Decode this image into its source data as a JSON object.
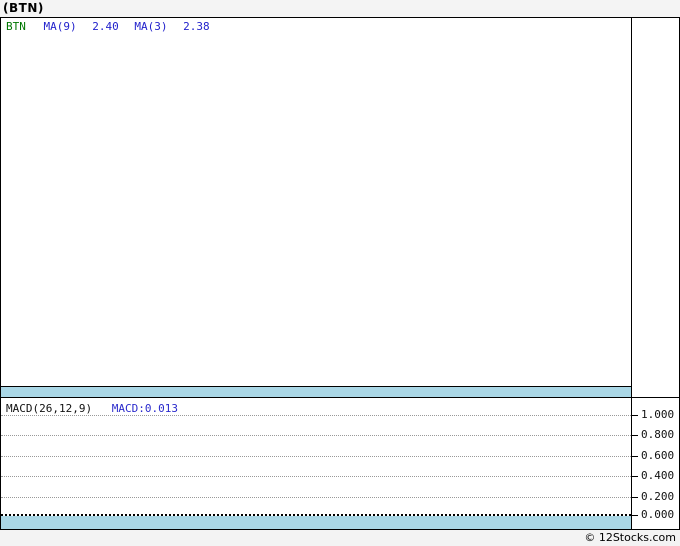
{
  "title": "(BTN)",
  "price_panel": {
    "legend": {
      "symbol": "BTN",
      "ma9_label": "MA(9)",
      "ma9_value": "2.40",
      "ma3_label": "MA(3)",
      "ma3_value": "2.38"
    }
  },
  "macd_panel": {
    "legend_label": "MACD(26,12,9)",
    "legend_value": "MACD:0.013",
    "axis": {
      "labels": [
        "1.000",
        "0.800",
        "0.600",
        "0.400",
        "0.200",
        "0.000"
      ]
    }
  },
  "footer": {
    "credit": "© 12Stocks.com"
  },
  "colors": {
    "symbol_green": "#007700",
    "indicator_blue": "#2222cc",
    "band_blue": "#aad7e6",
    "grid_gray": "#999999",
    "titlebar_gray": "#f4f4f4"
  },
  "chart_data": [
    {
      "type": "line",
      "title": "(BTN) price with moving averages",
      "series": [
        {
          "name": "BTN",
          "color": "#007700",
          "values": []
        },
        {
          "name": "MA(9)",
          "color": "#2222cc",
          "last_value": 2.4
        },
        {
          "name": "MA(3)",
          "color": "#2222cc",
          "last_value": 2.38
        }
      ],
      "grid": false,
      "legend_position": "top-left",
      "note": "plot area is empty - no visible price data points"
    },
    {
      "type": "line",
      "title": "MACD(26,12,9)",
      "series": [
        {
          "name": "MACD",
          "last_value": 0.013
        }
      ],
      "yticks": [
        1.0,
        0.8,
        0.6,
        0.4,
        0.2,
        0.0
      ],
      "ylim": [
        0.0,
        1.15
      ],
      "grid": true,
      "legend_position": "top-left",
      "note": "plot area is empty - no visible MACD line; zero level drawn as black dotted line"
    }
  ]
}
